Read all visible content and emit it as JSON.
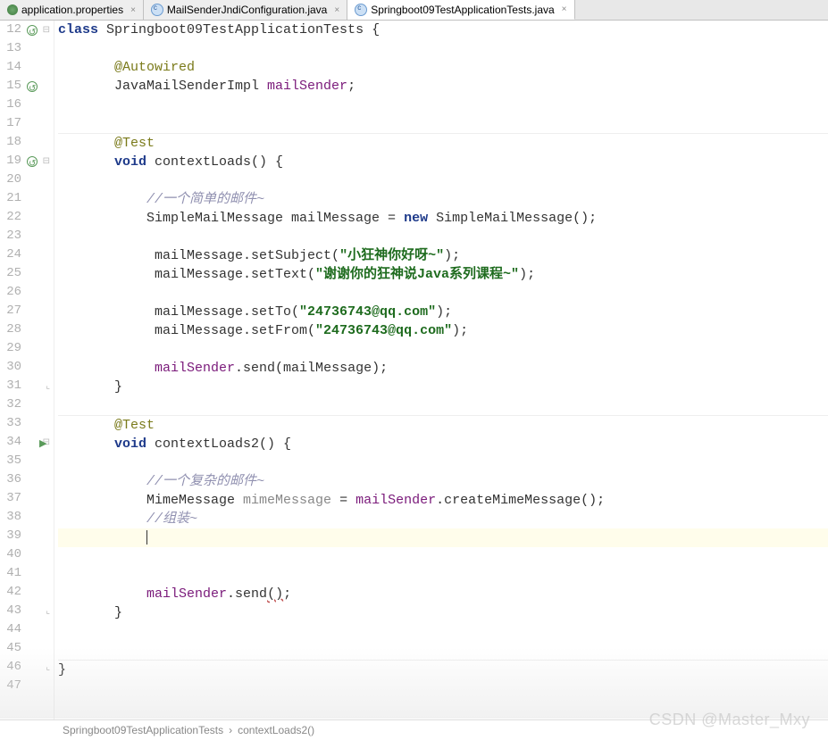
{
  "tabs": [
    {
      "label": "application.properties",
      "iconKind": "leaf",
      "active": false
    },
    {
      "label": "MailSenderJndiConfiguration.java",
      "iconKind": "java",
      "active": false
    },
    {
      "label": "Springboot09TestApplicationTests.java",
      "iconKind": "java",
      "active": true
    }
  ],
  "gutter": {
    "start": 12,
    "end": 47,
    "overrideIcons": [
      12,
      15,
      19
    ],
    "runIcons": [
      34
    ],
    "foldOpen": [
      12,
      19,
      34
    ],
    "foldClose": [
      31,
      43,
      46
    ]
  },
  "code": {
    "12": {
      "indent": 0,
      "tokens": [
        [
          "kw",
          "class"
        ],
        [
          "",
          " Springboot09TestApplicationTests {"
        ]
      ]
    },
    "13": {
      "indent": 0,
      "tokens": []
    },
    "14": {
      "indent": 1,
      "tokens": [
        [
          "anno",
          "@Autowired"
        ]
      ]
    },
    "15": {
      "indent": 1,
      "tokens": [
        [
          "",
          "JavaMailSenderImpl "
        ],
        [
          "field",
          "mailSender"
        ],
        [
          "",
          ";"
        ]
      ]
    },
    "16": {
      "indent": 0,
      "tokens": []
    },
    "17": {
      "indent": 0,
      "tokens": []
    },
    "18": {
      "indent": 1,
      "tokens": [
        [
          "anno",
          "@Test"
        ]
      ],
      "sep": true
    },
    "19": {
      "indent": 1,
      "tokens": [
        [
          "kw",
          "void"
        ],
        [
          "",
          " contextLoads() {"
        ]
      ]
    },
    "20": {
      "indent": 0,
      "tokens": []
    },
    "21": {
      "indent": 2,
      "tokens": [
        [
          "comment",
          "//一个简单的邮件~"
        ]
      ]
    },
    "22": {
      "indent": 2,
      "tokens": [
        [
          "",
          "SimpleMailMessage mailMessage = "
        ],
        [
          "kw",
          "new"
        ],
        [
          "",
          " SimpleMailMessage();"
        ]
      ]
    },
    "23": {
      "indent": 0,
      "tokens": []
    },
    "24": {
      "indent": 2,
      "tokens": [
        [
          "",
          " mailMessage.setSubject("
        ],
        [
          "str",
          "\"小狂神你好呀~\""
        ],
        [
          "",
          ");"
        ]
      ]
    },
    "25": {
      "indent": 2,
      "tokens": [
        [
          "",
          " mailMessage.setText("
        ],
        [
          "str",
          "\"谢谢你的狂神说Java系列课程~\""
        ],
        [
          "",
          ");"
        ]
      ]
    },
    "26": {
      "indent": 0,
      "tokens": []
    },
    "27": {
      "indent": 2,
      "tokens": [
        [
          "",
          " mailMessage.setTo("
        ],
        [
          "str",
          "\"24736743@qq.com\""
        ],
        [
          "",
          ");"
        ]
      ]
    },
    "28": {
      "indent": 2,
      "tokens": [
        [
          "",
          " mailMessage.setFrom("
        ],
        [
          "str",
          "\"24736743@qq.com\""
        ],
        [
          "",
          ");"
        ]
      ]
    },
    "29": {
      "indent": 0,
      "tokens": []
    },
    "30": {
      "indent": 2,
      "tokens": [
        [
          "",
          " "
        ],
        [
          "field",
          "mailSender"
        ],
        [
          "",
          ".send(mailMessage);"
        ]
      ]
    },
    "31": {
      "indent": 1,
      "tokens": [
        [
          "",
          "}"
        ]
      ]
    },
    "32": {
      "indent": 0,
      "tokens": []
    },
    "33": {
      "indent": 1,
      "tokens": [
        [
          "anno",
          "@Test"
        ]
      ],
      "sep": true
    },
    "34": {
      "indent": 1,
      "tokens": [
        [
          "kw",
          "void"
        ],
        [
          "",
          " contextLoads2() {"
        ]
      ]
    },
    "35": {
      "indent": 0,
      "tokens": []
    },
    "36": {
      "indent": 2,
      "tokens": [
        [
          "comment",
          "//一个复杂的邮件~"
        ]
      ]
    },
    "37": {
      "indent": 2,
      "tokens": [
        [
          "",
          "MimeMessage "
        ],
        [
          "gray",
          "mimeMessage"
        ],
        [
          "",
          " = "
        ],
        [
          "field",
          "mailSender"
        ],
        [
          "",
          ".createMimeMessage();"
        ]
      ]
    },
    "38": {
      "indent": 2,
      "tokens": [
        [
          "comment",
          "//组装~"
        ]
      ]
    },
    "39": {
      "indent": 2,
      "tokens": [],
      "cursor": true
    },
    "40": {
      "indent": 0,
      "tokens": []
    },
    "41": {
      "indent": 0,
      "tokens": []
    },
    "42": {
      "indent": 2,
      "tokens": [
        [
          "field",
          "mailSender"
        ],
        [
          "",
          ".send"
        ],
        [
          "err",
          "("
        ],
        [
          "err",
          ")"
        ],
        [
          "",
          ";"
        ]
      ]
    },
    "43": {
      "indent": 1,
      "tokens": [
        [
          "",
          "}"
        ]
      ]
    },
    "44": {
      "indent": 0,
      "tokens": []
    },
    "45": {
      "indent": 0,
      "tokens": []
    },
    "46": {
      "indent": 0,
      "tokens": [
        [
          "",
          "}"
        ]
      ],
      "sep": true
    },
    "47": {
      "indent": 0,
      "tokens": []
    }
  },
  "breadcrumb": {
    "class": "Springboot09TestApplicationTests",
    "method": "contextLoads2()"
  },
  "watermark": "CSDN @Master_Mxy"
}
